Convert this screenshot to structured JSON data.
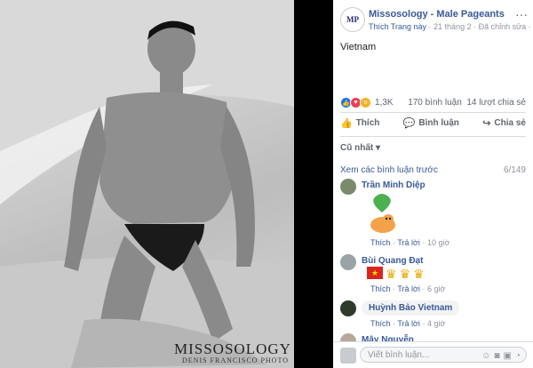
{
  "photo": {
    "watermark": "MISSOSOLOGY",
    "watermark_sub": "DENIS FRANCISCO PHOTO"
  },
  "post": {
    "page_avatar_text": "MP",
    "page_name": "Missosology - Male Pageants",
    "like_page": "Thích Trang này",
    "meta_rest": " · 21 tháng 2 · Đã chỉnh sửa · ",
    "caption": "Vietnam",
    "reaction_count": "1,3K",
    "comments_count": "170 bình luận",
    "shares_count": "14 lượt chia sẻ",
    "more_icon": "more-dots-icon"
  },
  "actions": {
    "like": "Thích",
    "comment": "Bình luận",
    "share": "Chia sẻ"
  },
  "comments_section": {
    "sort_label": "Cũ nhất",
    "view_previous": "Xem các bình luận trước",
    "count": "6/149",
    "items": [
      {
        "name": "Trần Minh Diệp",
        "like": "Thích",
        "reply": "Trả lời",
        "time": "10 giờ"
      },
      {
        "name": "Bùi Quang Đạt",
        "like": "Thích",
        "reply": "Trả lời",
        "time": "6 giờ"
      },
      {
        "name": "Huỳnh Bảo Vietnam",
        "like": "Thích",
        "reply": "Trả lời",
        "time": "4 giờ"
      },
      {
        "name": "Mây Nguyễn"
      }
    ]
  },
  "composer": {
    "placeholder": "Viết bình luận..."
  },
  "colors": {
    "link": "#385898",
    "like_blue": "#1877f2",
    "muted": "#90949c"
  }
}
